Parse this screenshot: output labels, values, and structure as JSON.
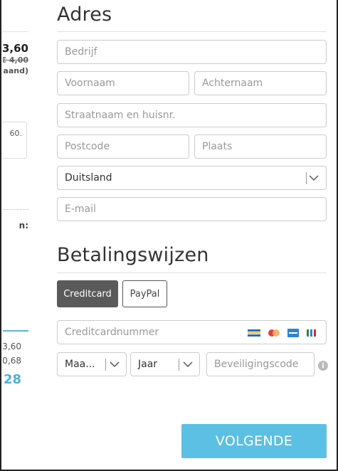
{
  "summary": {
    "price": "3,60",
    "old_price": "€ 4,00",
    "period": "aand)",
    "box_text": "60.",
    "colon_label": "n:",
    "line1": "3,60",
    "line2": "0,68",
    "total": "28"
  },
  "address": {
    "heading": "Adres",
    "company_placeholder": "Bedrijf",
    "firstname_placeholder": "Voornaam",
    "lastname_placeholder": "Achternaam",
    "street_placeholder": "Straatnaam en huisnr.",
    "postcode_placeholder": "Postcode",
    "city_placeholder": "Plaats",
    "country": "Duitsland",
    "email_placeholder": "E-mail"
  },
  "payment": {
    "heading": "Betalingswijzen",
    "methods": [
      "Creditcard",
      "PayPal"
    ],
    "card_number_placeholder": "Creditcardnummer",
    "card_icons": [
      "amex-card-icon",
      "mastercard-icon",
      "visa-card-icon",
      "card-icon"
    ],
    "month": "Maa...",
    "year": "Jaar",
    "cvc_placeholder": "Beveiligingscode"
  },
  "actions": {
    "next_label": "VOLGENDE"
  },
  "colors": {
    "accent": "#5bc0e3",
    "active_tab": "#5a5a5a"
  }
}
